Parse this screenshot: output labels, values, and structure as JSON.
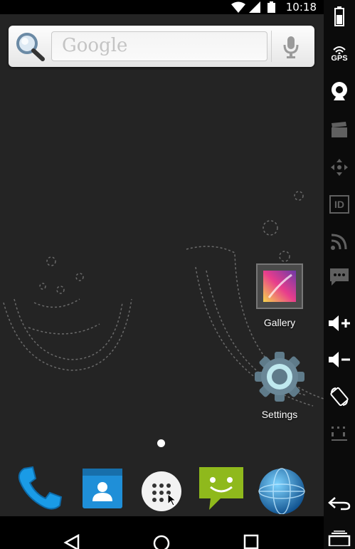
{
  "status_bar": {
    "time": "10:18"
  },
  "search": {
    "placeholder": "Google",
    "icons": [
      "search-icon",
      "mic-icon"
    ]
  },
  "desktop": {
    "apps": [
      {
        "label": "Gallery",
        "icon": "gallery-icon"
      },
      {
        "label": "Settings",
        "icon": "gear-icon"
      }
    ]
  },
  "dock": {
    "items": [
      {
        "icon": "phone-icon"
      },
      {
        "icon": "contacts-icon"
      },
      {
        "icon": "app-drawer-icon"
      },
      {
        "icon": "messaging-icon"
      },
      {
        "icon": "browser-icon"
      }
    ]
  },
  "nav": {
    "icons": [
      "back-icon",
      "home-icon",
      "recents-icon"
    ]
  },
  "emulator_panel": {
    "gps_label": "GPS",
    "id_label": "ID",
    "colors": {
      "panel_bg": "#0b0b0b",
      "icon": "#ffffff",
      "disabled": "#5a5a5a"
    },
    "buttons": [
      "battery-icon",
      "gps-icon",
      "webcam-icon",
      "clapperboard-icon",
      "dpad-icon",
      "id-icon",
      "rss-icon",
      "sms-icon",
      "volume-up-icon",
      "volume-down-icon",
      "rotate-icon",
      "pixel-ratio-icon",
      "back-arrow-icon",
      "recents-icon"
    ]
  }
}
